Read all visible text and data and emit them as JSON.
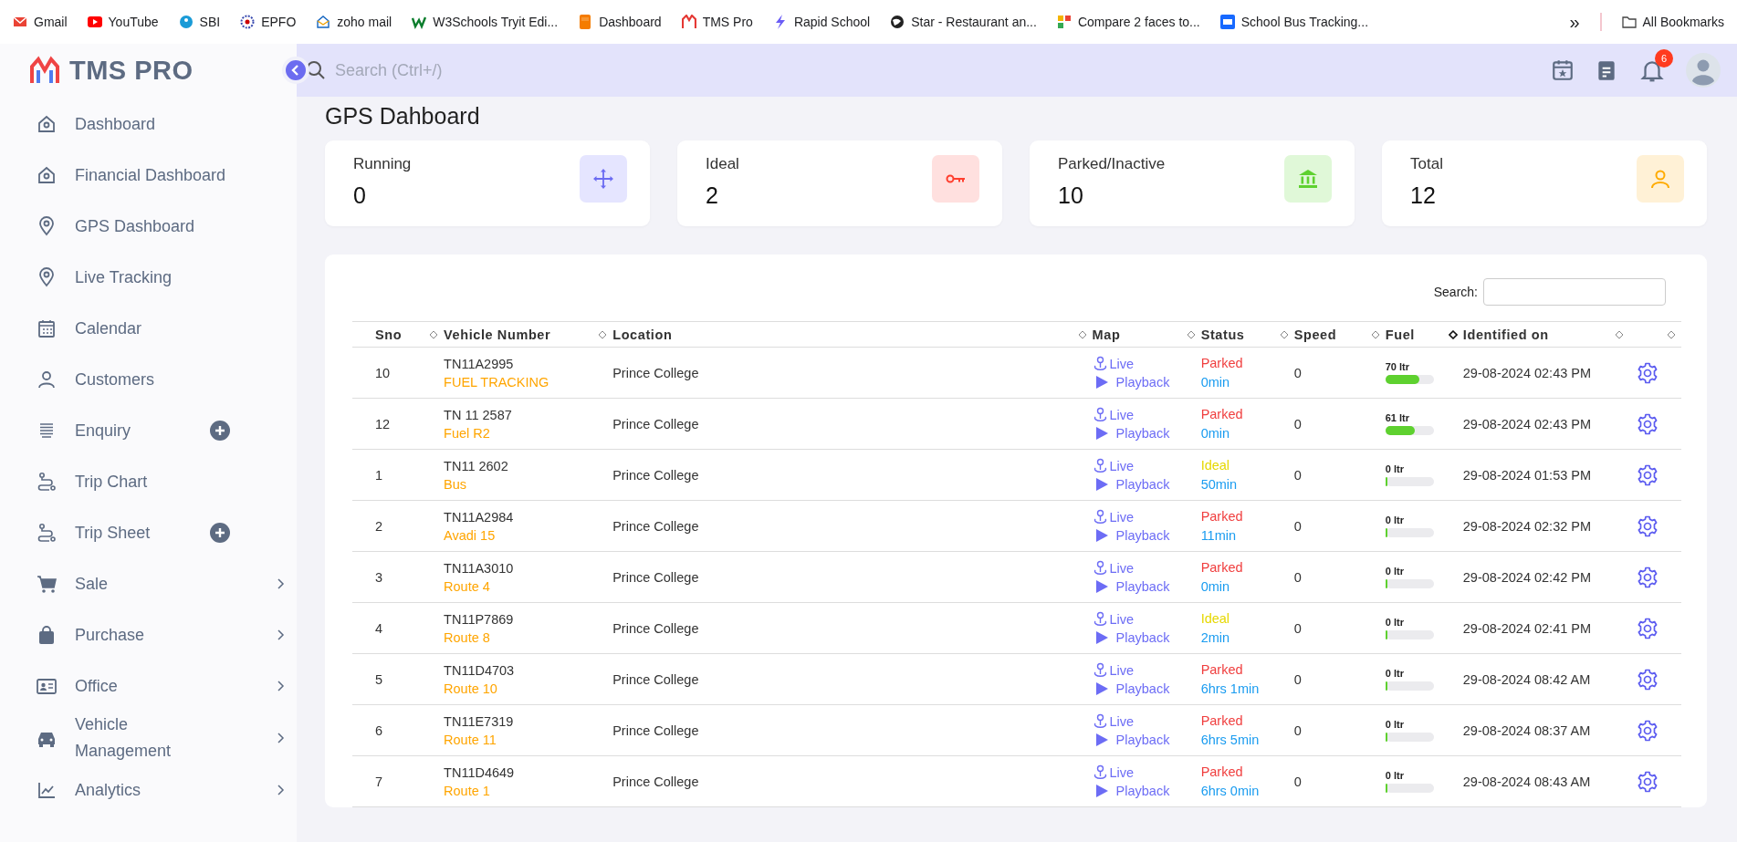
{
  "bookmarks": {
    "items": [
      "Gmail",
      "YouTube",
      "SBI",
      "EPFO",
      "zoho mail",
      "W3Schools Tryit Edi...",
      "Dashboard",
      "TMS Pro",
      "Rapid School",
      "Star - Restaurant an...",
      "Compare 2 faces to...",
      "School Bus Tracking..."
    ],
    "overflow": "»",
    "all": "All Bookmarks"
  },
  "brand": "TMS PRO",
  "search": {
    "placeholder": "Search (Ctrl+/)"
  },
  "notifications": {
    "count": "6"
  },
  "sidebar": {
    "items": [
      {
        "label": "Dashboard",
        "kind": "plain"
      },
      {
        "label": "Financial Dashboard",
        "kind": "plain"
      },
      {
        "label": "GPS Dashboard",
        "kind": "plain"
      },
      {
        "label": "Live Tracking",
        "kind": "plain"
      },
      {
        "label": "Calendar",
        "kind": "plain"
      },
      {
        "label": "Customers",
        "kind": "plain"
      },
      {
        "label": "Enquiry",
        "kind": "plus"
      },
      {
        "label": "Trip Chart",
        "kind": "plain"
      },
      {
        "label": "Trip Sheet",
        "kind": "plus"
      },
      {
        "label": "Sale",
        "kind": "chevron"
      },
      {
        "label": "Purchase",
        "kind": "chevron"
      },
      {
        "label": "Office",
        "kind": "chevron"
      },
      {
        "label": "Vehicle Management",
        "kind": "chevron"
      },
      {
        "label": "Analytics",
        "kind": "chevron"
      }
    ]
  },
  "page_title": "GPS Dahboard",
  "stats": [
    {
      "label": "Running",
      "value": "0",
      "kind": "move"
    },
    {
      "label": "Ideal",
      "value": "2",
      "kind": "key"
    },
    {
      "label": "Parked/Inactive",
      "value": "10",
      "kind": "bank"
    },
    {
      "label": "Total",
      "value": "12",
      "kind": "user"
    }
  ],
  "table": {
    "search_label": "Search:",
    "columns": [
      {
        "label": "Sno",
        "sorted": false
      },
      {
        "label": "Vehicle Number",
        "sorted": false
      },
      {
        "label": "Location",
        "sorted": false
      },
      {
        "label": "Map",
        "sorted": false
      },
      {
        "label": "Status",
        "sorted": false
      },
      {
        "label": "Speed",
        "sorted": false
      },
      {
        "label": "Fuel",
        "sorted": true
      },
      {
        "label": "Identified on",
        "sorted": false
      },
      {
        "sorted": false
      }
    ],
    "rows": [
      {
        "sno": "10",
        "vehicle": "TN11A2995",
        "route": "FUEL TRACKING",
        "location": "Prince College",
        "live": "Live",
        "playback": "Playback",
        "status": {
          "text": "Parked",
          "color": "#f03e3e"
        },
        "duration": "0min",
        "speed": "0",
        "fuel": "70 ltr",
        "level": 0.7,
        "identified": "29-08-2024 02:43 PM"
      },
      {
        "sno": "12",
        "vehicle": "TN 11 2587",
        "route": "Fuel R2",
        "location": "Prince College",
        "live": "Live",
        "playback": "Playback",
        "status": {
          "text": "Parked",
          "color": "#f03e3e"
        },
        "duration": "0min",
        "speed": "0",
        "fuel": "61 ltr",
        "level": 0.61,
        "identified": "29-08-2024 02:43 PM"
      },
      {
        "sno": "1",
        "vehicle": "TN11 2602",
        "route": "Bus",
        "location": "Prince College",
        "live": "Live",
        "playback": "Playback",
        "status": {
          "text": "Ideal",
          "color": "#e6d800"
        },
        "duration": "50min",
        "speed": "0",
        "fuel": "0 ltr",
        "level": 0,
        "identified": "29-08-2024 01:53 PM"
      },
      {
        "sno": "2",
        "vehicle": "TN11A2984",
        "route": "Avadi 15",
        "location": "Prince College",
        "live": "Live",
        "playback": "Playback",
        "status": {
          "text": "Parked",
          "color": "#f03e3e"
        },
        "duration": "11min",
        "speed": "0",
        "fuel": "0 ltr",
        "level": 0,
        "identified": "29-08-2024 02:32 PM"
      },
      {
        "sno": "3",
        "vehicle": "TN11A3010",
        "route": "Route 4",
        "location": "Prince College",
        "live": "Live",
        "playback": "Playback",
        "status": {
          "text": "Parked",
          "color": "#f03e3e"
        },
        "duration": "0min",
        "speed": "0",
        "fuel": "0 ltr",
        "level": 0,
        "identified": "29-08-2024 02:42 PM"
      },
      {
        "sno": "4",
        "vehicle": "TN11P7869",
        "route": "Route 8",
        "location": "Prince College",
        "live": "Live",
        "playback": "Playback",
        "status": {
          "text": "Ideal",
          "color": "#e6d800"
        },
        "duration": "2min",
        "speed": "0",
        "fuel": "0 ltr",
        "level": 0,
        "identified": "29-08-2024 02:41 PM"
      },
      {
        "sno": "5",
        "vehicle": "TN11D4703",
        "route": "Route 10",
        "location": "Prince College",
        "live": "Live",
        "playback": "Playback",
        "status": {
          "text": "Parked",
          "color": "#f03e3e"
        },
        "duration": "6hrs 1min",
        "speed": "0",
        "fuel": "0 ltr",
        "level": 0,
        "identified": "29-08-2024 08:42 AM"
      },
      {
        "sno": "6",
        "vehicle": "TN11E7319",
        "route": "Route 11",
        "location": "Prince College",
        "live": "Live",
        "playback": "Playback",
        "status": {
          "text": "Parked",
          "color": "#f03e3e"
        },
        "duration": "6hrs 5min",
        "speed": "0",
        "fuel": "0 ltr",
        "level": 0,
        "identified": "29-08-2024 08:37 AM"
      },
      {
        "sno": "7",
        "vehicle": "TN11D4649",
        "route": "Route 1",
        "location": "Prince College",
        "live": "Live",
        "playback": "Playback",
        "status": {
          "text": "Parked",
          "color": "#f03e3e"
        },
        "duration": "6hrs 0min",
        "speed": "0",
        "fuel": "0 ltr",
        "level": 0,
        "identified": "29-08-2024 08:43 AM"
      }
    ]
  }
}
